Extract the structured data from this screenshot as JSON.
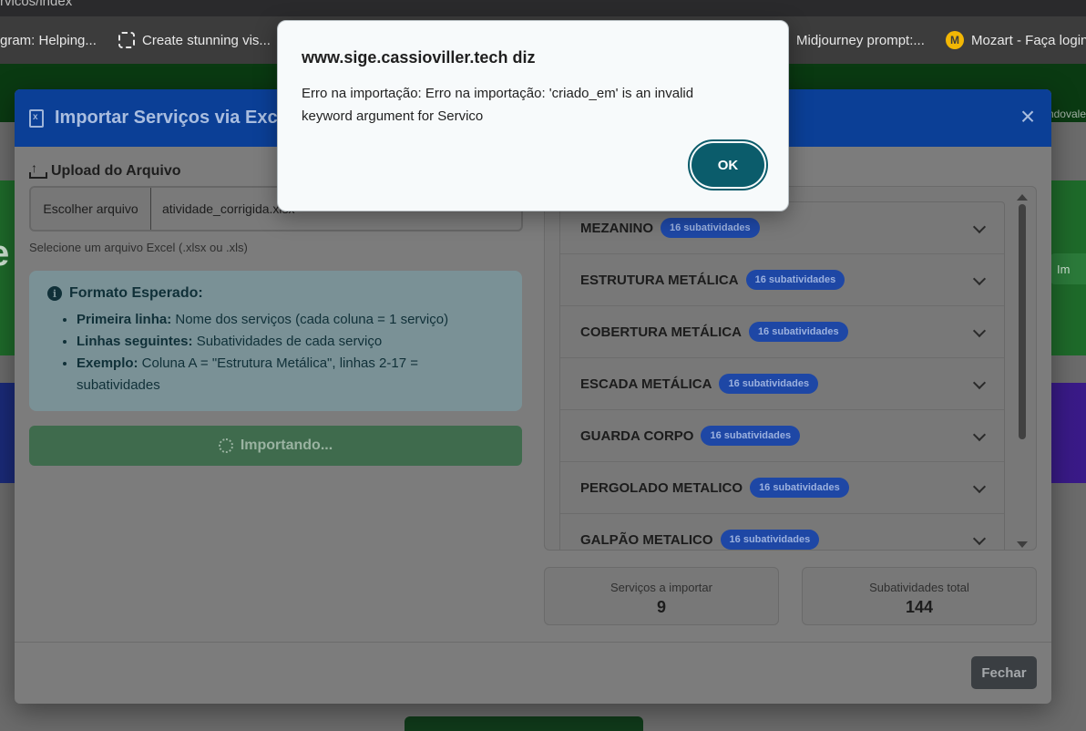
{
  "browser": {
    "url_fragment": "rvicos/index",
    "bookmarks": [
      {
        "label": "gram: Helping..."
      },
      {
        "label": "Create stunning vis..."
      },
      {
        "label": "Midjourney prompt:..."
      },
      {
        "label": "Mozart - Faça login"
      }
    ],
    "mozart_icon_letter": "M"
  },
  "background_page": {
    "side_text": "ndovale",
    "side_button": "Im"
  },
  "modal": {
    "title": "Importar Serviços via Excel",
    "close_symbol": "×",
    "upload": {
      "label": "Upload do Arquivo",
      "choose_button": "Escolher arquivo",
      "file_name": "atividade_corrigida.xlsx",
      "help": "Selecione um arquivo Excel (.xlsx ou .xls)"
    },
    "info": {
      "title": "Formato Esperado:",
      "items": [
        {
          "bold": "Primeira linha:",
          "text": " Nome dos serviços (cada coluna = 1 serviço)"
        },
        {
          "bold": "Linhas seguintes:",
          "text": " Subatividades de cada serviço"
        },
        {
          "bold": "Exemplo:",
          "text": " Coluna A = \"Estrutura Metálica\", linhas 2-17 = subatividades"
        }
      ]
    },
    "import_button": "Importando...",
    "services": [
      {
        "name": "MEZANINO",
        "badge": "16 subatividades"
      },
      {
        "name": "ESTRUTURA METÁLICA",
        "badge": "16 subatividades"
      },
      {
        "name": "COBERTURA METÁLICA",
        "badge": "16 subatividades"
      },
      {
        "name": "ESCADA METÁLICA",
        "badge": "16 subatividades"
      },
      {
        "name": "GUARDA CORPO",
        "badge": "16 subatividades"
      },
      {
        "name": "PERGOLADO METALICO",
        "badge": "16 subatividades"
      },
      {
        "name": "GALPÃO METALICO",
        "badge": "16 subatividades"
      }
    ],
    "stats": [
      {
        "label": "Serviços a importar",
        "value": "9"
      },
      {
        "label": "Subatividades total",
        "value": "144"
      }
    ],
    "footer_close": "Fechar"
  },
  "alert": {
    "title": "www.sige.cassioviller.tech diz",
    "message": "Erro na importação: Erro na importação: 'criado_em' is an invalid keyword argument for Servico",
    "ok_label": "OK"
  },
  "colors": {
    "modal_header": "#0b3f96",
    "alert_ok": "#0b5c6b",
    "badge": "#1e47a5",
    "import_button": "#3f6b4d"
  }
}
